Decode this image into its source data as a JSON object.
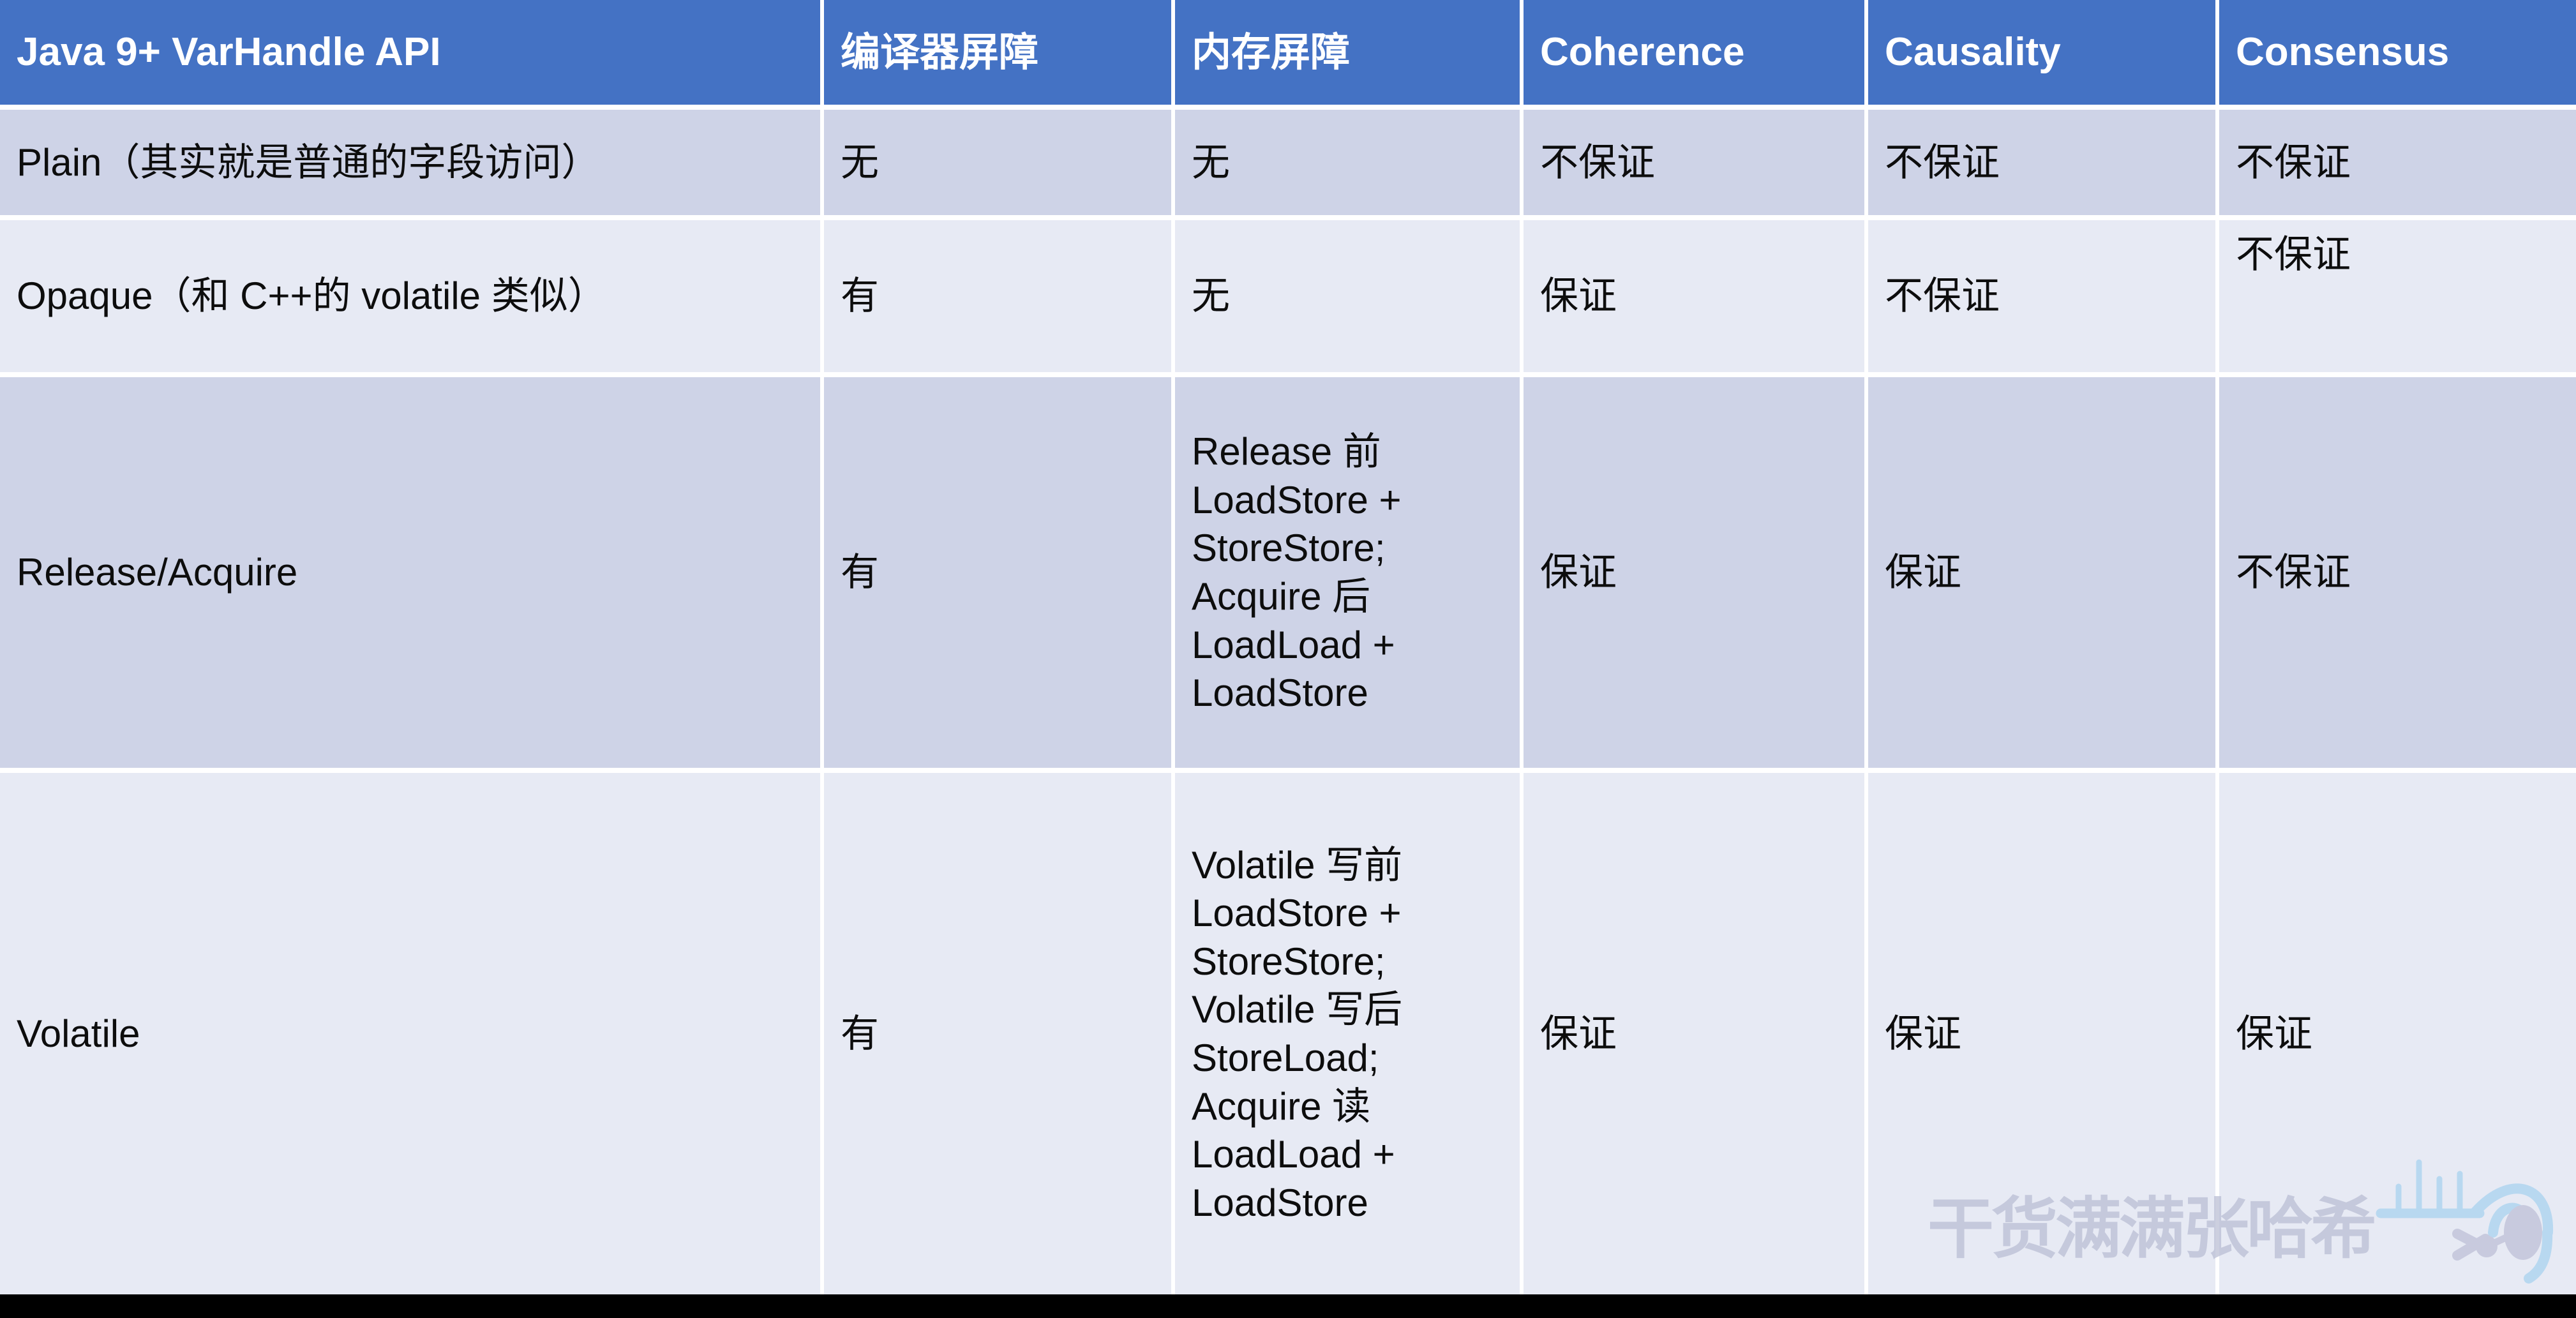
{
  "table": {
    "headers": [
      "Java 9+ VarHandle API",
      "编译器屏障",
      "内存屏障",
      "Coherence",
      "Causality",
      "Consensus"
    ],
    "rows": [
      {
        "api": "Plain（其实就是普通的字段访问）",
        "compiler_barrier": "无",
        "memory_barrier": "无",
        "coherence": "不保证",
        "causality": "不保证",
        "consensus": "不保证"
      },
      {
        "api": "Opaque（和 C++的 volatile 类似）",
        "compiler_barrier": "有",
        "memory_barrier": "无",
        "coherence": "保证",
        "causality": "不保证",
        "consensus": "不保证"
      },
      {
        "api": "Release/Acquire",
        "compiler_barrier": "有",
        "memory_barrier": "Release 前 LoadStore + StoreStore; Acquire 后 LoadLoad + LoadStore",
        "coherence": "保证",
        "causality": "保证",
        "consensus": "不保证"
      },
      {
        "api": "Volatile",
        "compiler_barrier": "有",
        "memory_barrier": "Volatile 写前 LoadStore + StoreStore; Volatile 写后 StoreLoad; Acquire 读 LoadLoad + LoadStore",
        "coherence": "保证",
        "causality": "保证",
        "consensus": "保证"
      }
    ]
  },
  "watermark": {
    "text": "干货满满张哈希",
    "icon": "radar-signal-icon"
  },
  "colors": {
    "header_background": "#4472c4",
    "header_text": "#ffffff",
    "row_band_dark": "#ced3e7",
    "row_band_light": "#e7eaf4",
    "body_text": "#0d0d0d",
    "gridline": "#ffffff",
    "watermark_text": "#b9bdd4",
    "watermark_icon": "#b8d8f0",
    "bottom_strip": "#000000"
  }
}
